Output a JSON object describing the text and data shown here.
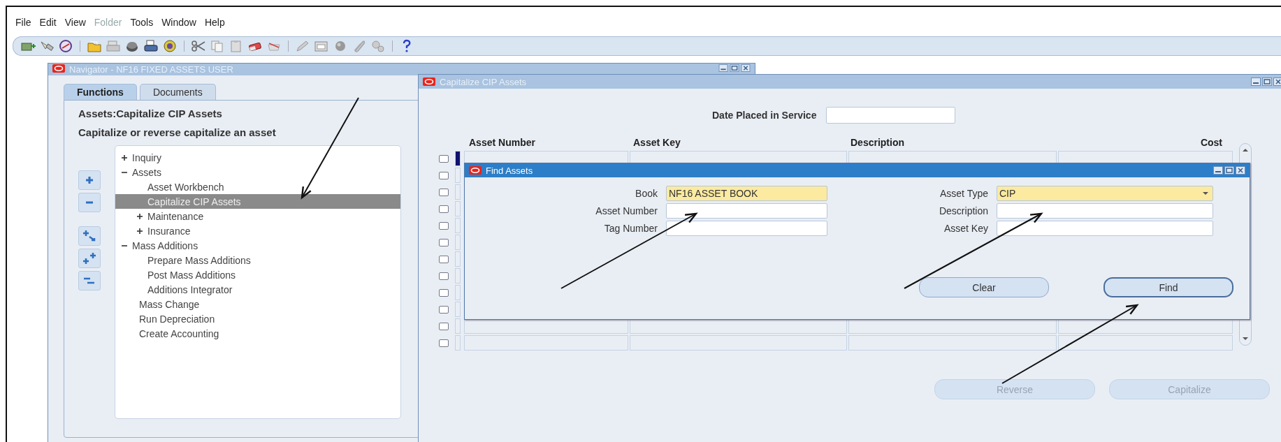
{
  "menu": [
    {
      "label": "File",
      "disabled": false
    },
    {
      "label": "Edit",
      "disabled": false
    },
    {
      "label": "View",
      "disabled": false
    },
    {
      "label": "Folder",
      "disabled": true
    },
    {
      "label": "Tools",
      "disabled": false
    },
    {
      "label": "Window",
      "disabled": false
    },
    {
      "label": "Help",
      "disabled": false
    }
  ],
  "toolbar": [
    {
      "kind": "new"
    },
    {
      "kind": "flashlight"
    },
    {
      "kind": "compass"
    },
    {
      "kind": "separator"
    },
    {
      "kind": "folder"
    },
    {
      "kind": "printer-grey"
    },
    {
      "kind": "disk"
    },
    {
      "kind": "printer"
    },
    {
      "kind": "shield"
    },
    {
      "kind": "separator"
    },
    {
      "kind": "scissors"
    },
    {
      "kind": "copy"
    },
    {
      "kind": "paste"
    },
    {
      "kind": "eraser"
    },
    {
      "kind": "trash"
    },
    {
      "kind": "separator"
    },
    {
      "kind": "pencil"
    },
    {
      "kind": "window"
    },
    {
      "kind": "ball"
    },
    {
      "kind": "paperclip"
    },
    {
      "kind": "gears"
    },
    {
      "kind": "separator"
    },
    {
      "kind": "help"
    }
  ],
  "navigator": {
    "title": "Navigator - NF16 FIXED ASSETS USER",
    "active": false,
    "tabs": [
      {
        "label": "Functions",
        "selected": true
      },
      {
        "label": "Documents",
        "selected": false
      }
    ],
    "heading": "Assets:Capitalize CIP Assets",
    "description": "Capitalize or reverse capitalize an asset",
    "tree": [
      {
        "label": "Inquiry",
        "expanded": false,
        "selected": false
      },
      {
        "label": "Assets",
        "expanded": true,
        "selected": false,
        "children": [
          {
            "label": "Asset Workbench",
            "selected": false
          },
          {
            "label": "Capitalize CIP Assets",
            "selected": true
          },
          {
            "label": "Maintenance",
            "expanded": false,
            "selected": false
          },
          {
            "label": "Insurance",
            "expanded": false,
            "selected": false
          }
        ]
      },
      {
        "label": "Mass Additions",
        "expanded": true,
        "selected": false,
        "children": [
          {
            "label": "Prepare Mass Additions",
            "selected": false
          },
          {
            "label": "Post Mass Additions",
            "selected": false
          },
          {
            "label": "Additions Integrator",
            "selected": false
          }
        ]
      },
      {
        "label": "Mass Change",
        "selected": false
      },
      {
        "label": "Run Depreciation",
        "selected": false
      },
      {
        "label": "Create Accounting",
        "selected": false
      }
    ]
  },
  "capitalize_window": {
    "title": "Capitalize CIP Assets",
    "active": false,
    "date_label": "Date Placed in Service",
    "columns": [
      {
        "label": "Asset Number"
      },
      {
        "label": "Asset Key"
      },
      {
        "label": "Description"
      },
      {
        "label": "Cost"
      }
    ],
    "rows": [
      {
        "checked": false
      },
      {
        "checked": false
      },
      {
        "checked": false
      },
      {
        "checked": false
      },
      {
        "checked": false
      },
      {
        "checked": false
      },
      {
        "checked": false
      },
      {
        "checked": false
      },
      {
        "checked": false
      },
      {
        "checked": false
      },
      {
        "checked": false
      },
      {
        "checked": false
      }
    ],
    "buttons": [
      {
        "label": "Reverse",
        "disabled": true
      },
      {
        "label": "Capitalize",
        "disabled": true
      }
    ]
  },
  "find_dialog": {
    "title": "Find Assets",
    "active": true,
    "field_columns": [
      {
        "fields": [
          {
            "label": "Book",
            "value": "NF16 ASSET BOOK",
            "required": true,
            "kind": "text"
          },
          {
            "label": "Asset Number",
            "required": false,
            "kind": "text"
          },
          {
            "label": "Tag Number",
            "required": false,
            "kind": "text"
          }
        ]
      },
      {
        "fields": [
          {
            "label": "Asset Type",
            "value": "CIP",
            "required": true,
            "kind": "list"
          },
          {
            "label": "Description",
            "required": false,
            "kind": "text"
          },
          {
            "label": "Asset Key",
            "required": false,
            "kind": "text"
          }
        ]
      }
    ],
    "buttons": [
      {
        "label": "Clear",
        "default": false
      },
      {
        "label": "Find",
        "default": true
      }
    ]
  }
}
